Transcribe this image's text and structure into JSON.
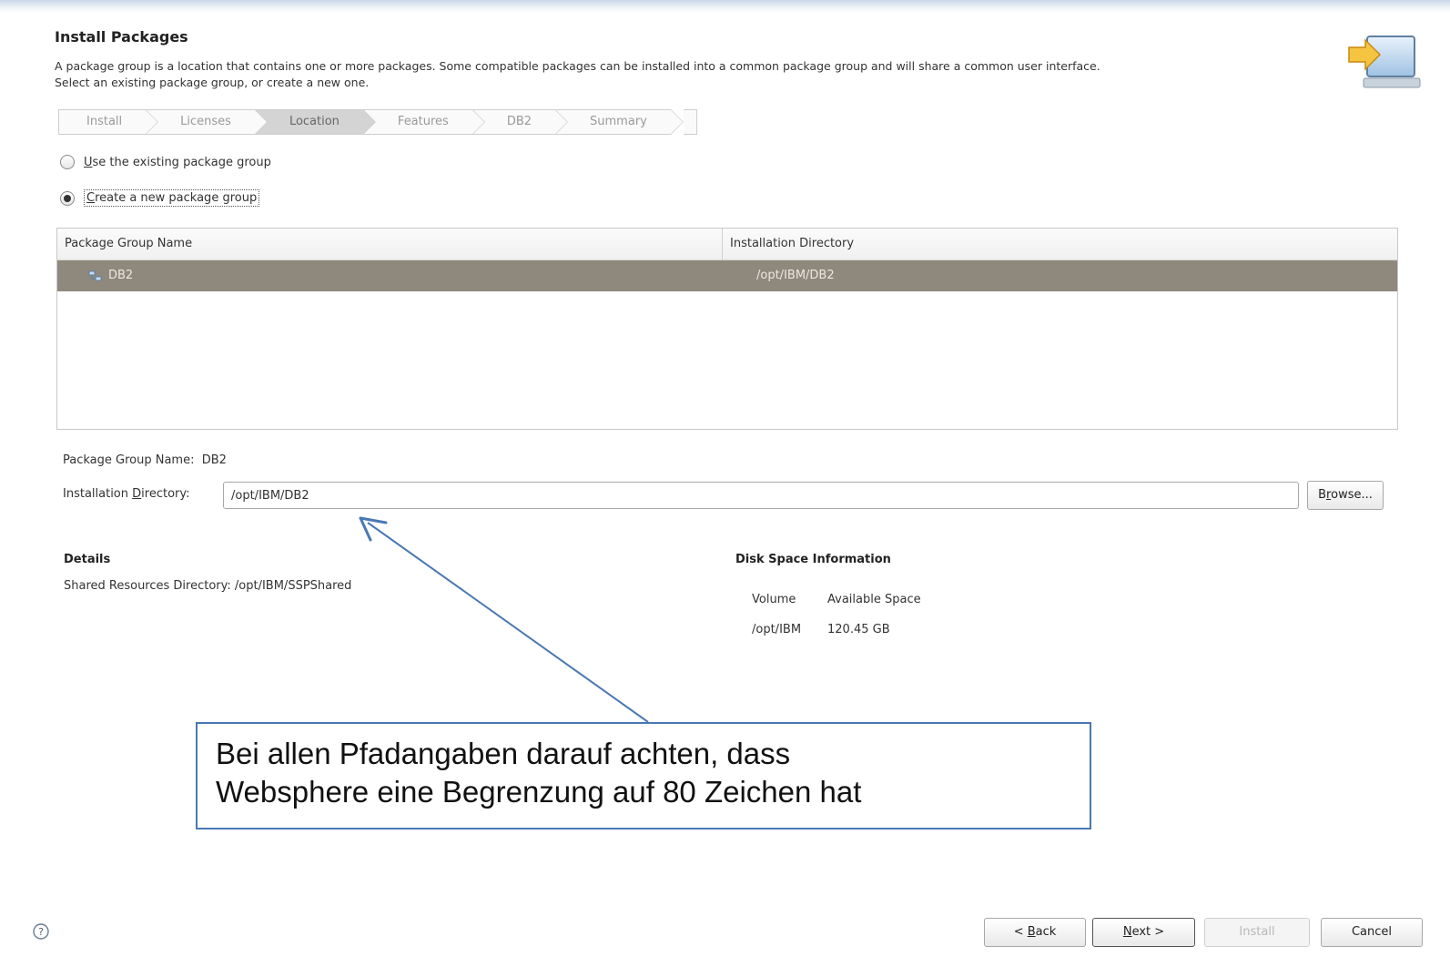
{
  "header": {
    "title": "Install Packages",
    "description_line1": "A package group is a location that contains one or more packages. Some compatible packages can be installed into a common package group and will share a common user interface.",
    "description_line2": "Select an existing package group, or create a new one."
  },
  "steps": [
    "Install",
    "Licenses",
    "Location",
    "Features",
    "DB2",
    "Summary"
  ],
  "active_step": "Location",
  "options": {
    "use_existing_pre": "",
    "use_existing_mn": "U",
    "use_existing_post": "se the existing package group",
    "create_new_mn": "C",
    "create_new_post": "reate a new package group",
    "selected": "create_new"
  },
  "table": {
    "col1": "Package Group Name",
    "col2": "Installation Directory",
    "rows": [
      {
        "name": "DB2",
        "dir": "/opt/IBM/DB2"
      }
    ]
  },
  "fields": {
    "group_name_label": "Package Group Name:",
    "group_name_value": "DB2",
    "install_dir_label_pre": "Installation ",
    "install_dir_label_mn": "D",
    "install_dir_label_post": "irectory:",
    "install_dir_value": "/opt/IBM/DB2",
    "browse_pre": "B",
    "browse_mn": "r",
    "browse_post": "owse..."
  },
  "details": {
    "title": "Details",
    "shared_resources": "Shared Resources Directory: /opt/IBM/SSPShared"
  },
  "disk_space": {
    "title": "Disk Space Information",
    "col_volume": "Volume",
    "col_available": "Available Space",
    "volume": "/opt/IBM",
    "available": "120.45 GB"
  },
  "annotation": {
    "line1": "Bei allen Pfadangaben darauf achten, dass",
    "line2": "Websphere eine Begrenzung auf 80 Zeichen hat",
    "border_color": "#4a78b4"
  },
  "footer": {
    "back_pre": "< ",
    "back_mn": "B",
    "back_post": "ack",
    "next_mn": "N",
    "next_post": "ext >",
    "install": "Install",
    "cancel": "Cancel"
  },
  "colors": {
    "selected_row_bg": "#8e897c",
    "selected_row_text": "#ece9e3"
  }
}
